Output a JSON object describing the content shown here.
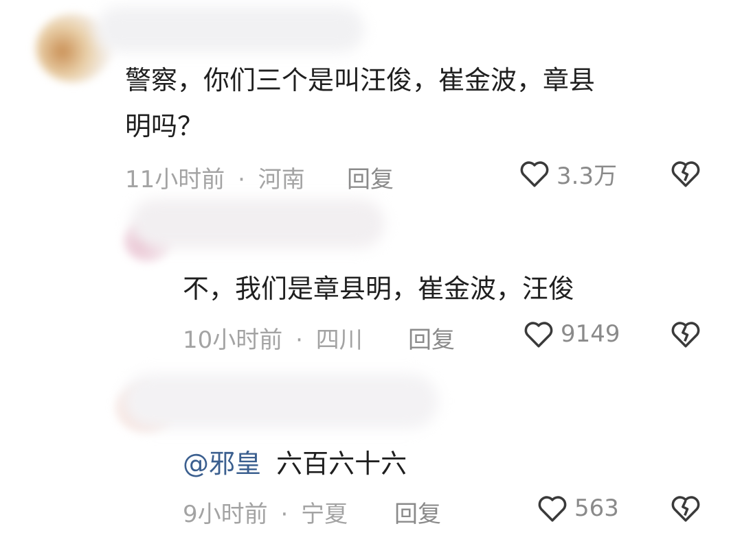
{
  "comments": [
    {
      "text_line1": "警察，你们三个是叫汪俊，崔金波，章县",
      "text_line2": "明吗？",
      "time": "11小时前",
      "separator": "·",
      "location": "河南",
      "reply_label": "回复",
      "like_count": "3.3万"
    },
    {
      "text_line1": "不，我们是章县明，崔金波，汪俊",
      "time": "10小时前",
      "separator": "·",
      "location": "四川",
      "reply_label": "回复",
      "like_count": "9149"
    },
    {
      "mention": "@邪皇",
      "text_line1": "六百六十六",
      "time": "9小时前",
      "separator": "·",
      "location": "宁夏",
      "reply_label": "回复",
      "like_count": "563"
    }
  ],
  "colors": {
    "mention": "#3b5f8f",
    "meta": "#a3a3a3",
    "action": "#8a8a8a",
    "text": "#1f1f1f"
  },
  "icons": [
    "heart-outline-icon",
    "broken-heart-icon"
  ]
}
